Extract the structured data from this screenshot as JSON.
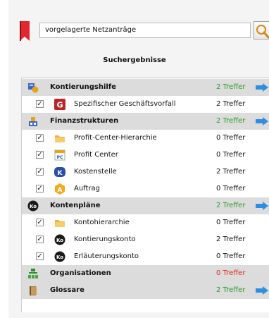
{
  "search": {
    "value": "vorgelagerte Netzanträge"
  },
  "heading": "Suchergebnisse",
  "colors": {
    "hits": "#2e9a2e",
    "no_hits": "#e0281e",
    "section_bg": "#dcdcdc",
    "arrow": "#2f8ee0"
  },
  "sections": [
    {
      "label": "Kontierungshilfe",
      "count": "2 Treffer",
      "icon": "kontierungshilfe-icon",
      "items": [
        {
          "label": "Spezifischer Geschäftsvorfall",
          "count": "2 Treffer",
          "icon": "g-icon",
          "checked": true
        }
      ]
    },
    {
      "label": "Finanzstrukturen",
      "count": "2 Treffer",
      "icon": "finanzstrukturen-icon",
      "items": [
        {
          "label": "Profit-Center-Hierarchie",
          "count": "0 Treffer",
          "icon": "folder-icon",
          "checked": true
        },
        {
          "label": "Profit Center",
          "count": "0 Treffer",
          "icon": "pc-icon",
          "checked": true
        },
        {
          "label": "Kostenstelle",
          "count": "2 Treffer",
          "icon": "k-icon",
          "checked": true
        },
        {
          "label": "Auftrag",
          "count": "0 Treffer",
          "icon": "a-icon",
          "checked": true
        }
      ]
    },
    {
      "label": "Kontenpläne",
      "count": "2 Treffer",
      "icon": "ko-icon",
      "items": [
        {
          "label": "Kontohierarchie",
          "count": "0 Treffer",
          "icon": "folder-icon",
          "checked": true
        },
        {
          "label": "Kontierungskonto",
          "count": "2 Treffer",
          "icon": "ko-icon",
          "checked": true
        },
        {
          "label": "Erläuterungskonto",
          "count": "0 Treffer",
          "icon": "ko-icon",
          "checked": true
        }
      ]
    },
    {
      "label": "Organisationen",
      "count": "0 Treffer",
      "icon": "org-icon",
      "items": []
    },
    {
      "label": "Glossare",
      "count": "2 Treffer",
      "icon": "glossary-icon",
      "items": []
    }
  ]
}
